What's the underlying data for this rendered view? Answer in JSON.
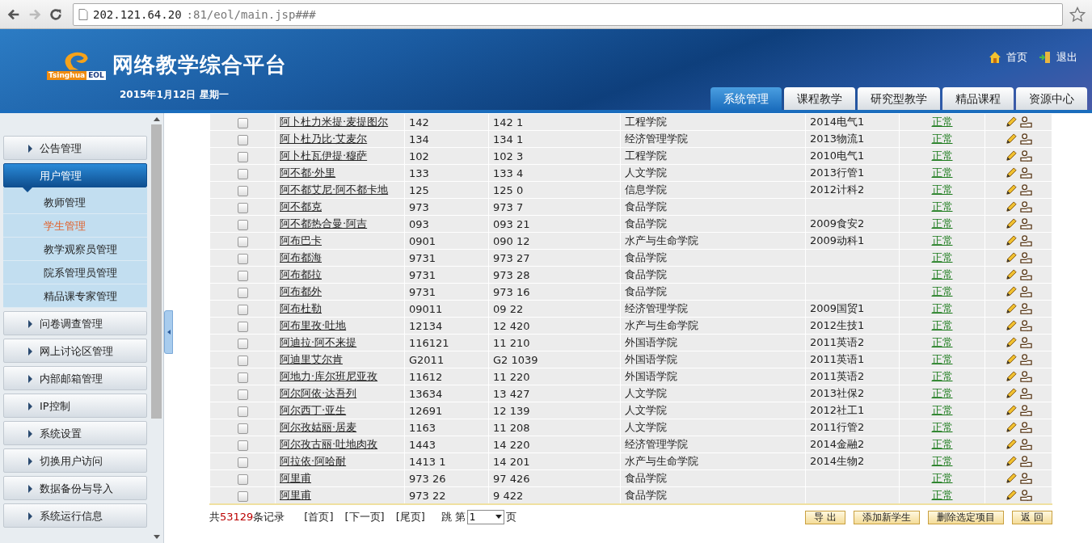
{
  "browser": {
    "url_host": "202.121.64.20",
    "url_path": ":81/eol/main.jsp###"
  },
  "header": {
    "logo_text": [
      "Tsinghua",
      "EOL"
    ],
    "title": "网络教学综合平台",
    "date": "2015年1月12日 星期一",
    "links": [
      {
        "label": "首页",
        "kind": "home"
      },
      {
        "label": "退出",
        "kind": "exit"
      }
    ]
  },
  "tabs": [
    {
      "label": "系统管理",
      "selected": true
    },
    {
      "label": "课程教学",
      "selected": false
    },
    {
      "label": "研究型教学",
      "selected": false
    },
    {
      "label": "精品课程",
      "selected": false
    },
    {
      "label": "资源中心",
      "selected": false
    }
  ],
  "sidebar": {
    "items": [
      {
        "label": "公告管理",
        "expanded": false
      },
      {
        "label": "用户管理",
        "expanded": true,
        "children": [
          {
            "label": "教师管理",
            "selected": false
          },
          {
            "label": "学生管理",
            "selected": true
          },
          {
            "label": "教学观察员管理",
            "selected": false
          },
          {
            "label": "院系管理员管理",
            "selected": false
          },
          {
            "label": "精品课专家管理",
            "selected": false
          }
        ]
      },
      {
        "label": "问卷调查管理",
        "expanded": false
      },
      {
        "label": "网上讨论区管理",
        "expanded": false
      },
      {
        "label": "内部邮箱管理",
        "expanded": false
      },
      {
        "label": "IP控制",
        "expanded": false
      },
      {
        "label": "系统设置",
        "expanded": false
      },
      {
        "label": "切换用户访问",
        "expanded": false
      },
      {
        "label": "数据备份与导入",
        "expanded": false
      },
      {
        "label": "系统运行信息",
        "expanded": false
      }
    ]
  },
  "table": {
    "rows": [
      {
        "checked": false,
        "name": "阿卜杜力米提·麦提图尔",
        "column_3": "142",
        "column_4": "142 1",
        "college": "工程学院",
        "class": "2014电气1",
        "status": "正常"
      },
      {
        "checked": false,
        "name": "阿卜杜乃比·艾麦尔",
        "column_3": "134",
        "column_4": "134 1",
        "college": "经济管理学院",
        "class": "2013物流1",
        "status": "正常"
      },
      {
        "checked": false,
        "name": "阿卜杜瓦伊提·穆萨",
        "column_3": "102",
        "column_4": "102 3",
        "college": "工程学院",
        "class": "2010电气1",
        "status": "正常"
      },
      {
        "checked": false,
        "name": "阿不都·外里",
        "column_3": "133",
        "column_4": "133 4",
        "college": "人文学院",
        "class": "2013行管1",
        "status": "正常"
      },
      {
        "checked": false,
        "name": "阿不都艾尼·阿不都卡地",
        "column_3": "125",
        "column_4": "125 0",
        "college": "信息学院",
        "class": "2012计科2",
        "status": "正常"
      },
      {
        "checked": false,
        "name": "阿不都克",
        "column_3": "973",
        "column_4": "973 7",
        "college": "食品学院",
        "status": "正常"
      },
      {
        "checked": false,
        "name": "阿不都热合曼·阿吉",
        "column_3": "093",
        "column_4": "093 21",
        "college": "食品学院",
        "class": "2009食安2",
        "status": "正常"
      },
      {
        "checked": false,
        "name": "阿布巴卡",
        "column_3": "0901",
        "column_4": "090 12",
        "college": "水产与生命学院",
        "class": "2009动科1",
        "status": "正常"
      },
      {
        "checked": false,
        "name": "阿布都海",
        "column_3": "9731",
        "column_4": "973 27",
        "college": "食品学院",
        "status": "正常"
      },
      {
        "checked": false,
        "name": "阿布都拉",
        "column_3": "9731",
        "column_4": "973 28",
        "college": "食品学院",
        "status": "正常"
      },
      {
        "checked": false,
        "name": "阿布都外",
        "column_3": "9731",
        "column_4": "973 16",
        "college": "食品学院",
        "status": "正常"
      },
      {
        "checked": false,
        "name": "阿布杜勒",
        "column_3": "09011",
        "column_4": "09 22",
        "college": "经济管理学院",
        "class": "2009国贸1",
        "status": "正常"
      },
      {
        "checked": false,
        "name": "阿布里孜·吐地",
        "column_3": "12134",
        "column_4": "12 420",
        "college": "水产与生命学院",
        "class": "2012生技1",
        "status": "正常"
      },
      {
        "checked": false,
        "name": "阿迪拉·阿不来提",
        "column_3": "116121",
        "column_4": "11 210",
        "college": "外国语学院",
        "class": "2011英语2",
        "status": "正常"
      },
      {
        "checked": false,
        "name": "阿迪里艾尔肯",
        "column_3": "G2011",
        "column_4": "G2 1039",
        "college": "外国语学院",
        "class": "2011英语1",
        "status": "正常"
      },
      {
        "checked": false,
        "name": "阿地力·库尔班尼亚孜",
        "column_3": "11612",
        "column_4": "11 220",
        "college": "外国语学院",
        "class": "2011英语2",
        "status": "正常"
      },
      {
        "checked": false,
        "name": "阿尔阿依·达吾列",
        "column_3": "13634",
        "column_4": "13 427",
        "college": "人文学院",
        "class": "2013社保2",
        "status": "正常"
      },
      {
        "checked": false,
        "name": "阿尔西丁·亚生",
        "column_3": "12691",
        "column_4": "12 139",
        "college": "人文学院",
        "class": "2012社工1",
        "status": "正常"
      },
      {
        "checked": false,
        "name": "阿尔孜姑丽·居麦",
        "column_3": "1163",
        "column_4": "11 208",
        "college": "人文学院",
        "class": "2011行管2",
        "status": "正常"
      },
      {
        "checked": false,
        "name": "阿尔孜古丽·吐地肉孜",
        "column_3": "1443",
        "column_4": "14 220",
        "college": "经济管理学院",
        "class": "2014金融2",
        "status": "正常"
      },
      {
        "checked": false,
        "name": "阿拉依·阿哈耐",
        "column_3": "1413 1",
        "column_4": "14 201",
        "college": "水产与生命学院",
        "class": "2014生物2",
        "status": "正常"
      },
      {
        "checked": false,
        "name": "阿里甫",
        "column_3": "973 26",
        "column_4": "97 426",
        "college": "食品学院",
        "status": "正常"
      },
      {
        "checked": false,
        "name": "阿里甫",
        "column_3": "973 22",
        "column_4": "9 422",
        "college": "食品学院",
        "status": "正常"
      }
    ]
  },
  "footer": {
    "total_prefix": "共",
    "total_count": "53129",
    "total_suffix": "条记录",
    "links": [
      "[首页]",
      "[下一页]",
      "[尾页]"
    ],
    "jump_prefix": "跳",
    "jump_label": "第",
    "page_value": "1",
    "page_suffix": "页",
    "buttons": [
      "导 出",
      "添加新学生",
      "删除选定项目",
      "返 回"
    ]
  }
}
